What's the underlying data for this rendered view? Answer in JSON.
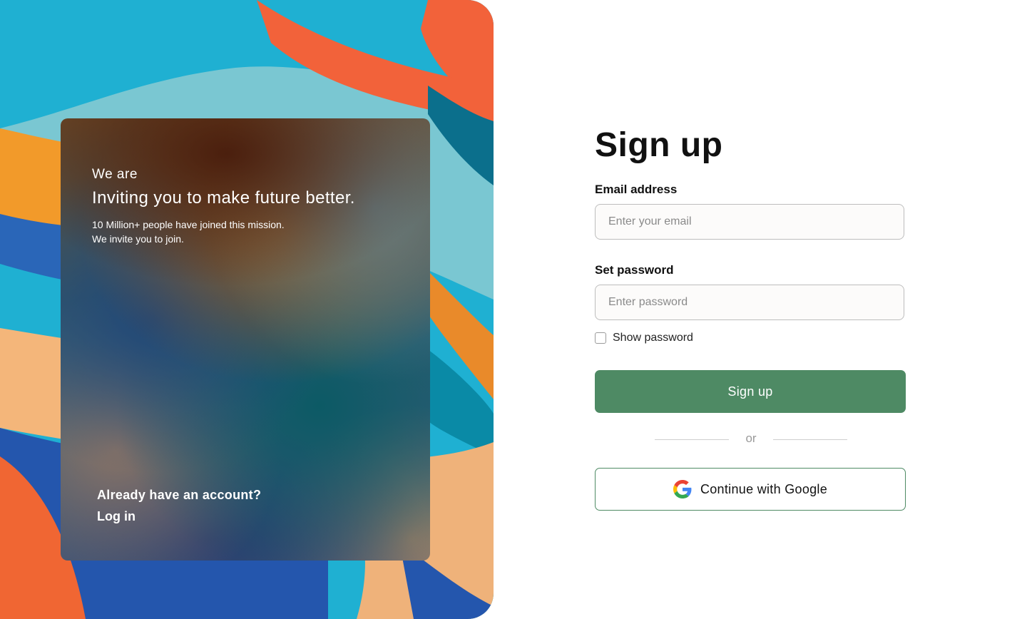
{
  "hero": {
    "eyebrow": "We are",
    "headline": "Inviting you to make future better.",
    "line1": "10 Million+ people have joined this mission.",
    "line2": "We invite you to join.",
    "account_prompt": "Already have an account?",
    "login_link": "Log in"
  },
  "form": {
    "title": "Sign up",
    "email_label": "Email address",
    "email_placeholder": "Enter your email",
    "email_value": "",
    "password_label": "Set password",
    "password_placeholder": "Enter password",
    "password_value": "",
    "show_password_label": "Show password",
    "show_password_checked": false,
    "submit_label": "Sign up",
    "divider_text": "or",
    "google_label": "Continue with Google"
  },
  "colors": {
    "accent": "#4e8a64",
    "input_border": "#bdbdbd",
    "divider": "#cfcfcf"
  },
  "icons": {
    "google": "google-g-logo"
  }
}
